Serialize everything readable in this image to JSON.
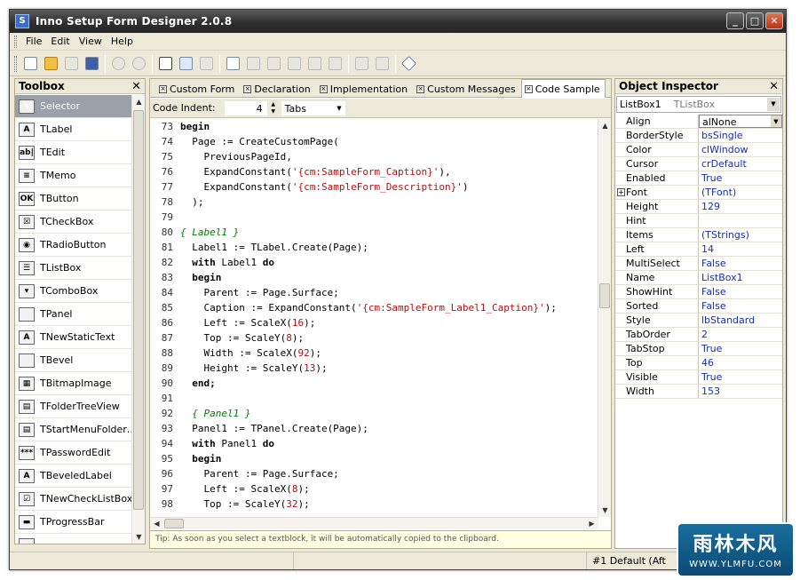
{
  "window": {
    "title": "Inno Setup Form Designer 2.0.8"
  },
  "menu": [
    "File",
    "Edit",
    "View",
    "Help"
  ],
  "toolbox": {
    "title": "Toolbox",
    "items": [
      {
        "label": "Selector",
        "icon": "cursor-icon",
        "glyph": "↖"
      },
      {
        "label": "TLabel",
        "icon": "label-icon",
        "glyph": "A"
      },
      {
        "label": "TEdit",
        "icon": "edit-icon",
        "glyph": "ab|"
      },
      {
        "label": "TMemo",
        "icon": "memo-icon",
        "glyph": "≡"
      },
      {
        "label": "TButton",
        "icon": "button-icon",
        "glyph": "OK"
      },
      {
        "label": "TCheckBox",
        "icon": "checkbox-icon",
        "glyph": "☒"
      },
      {
        "label": "TRadioButton",
        "icon": "radiobutton-icon",
        "glyph": "◉"
      },
      {
        "label": "TListBox",
        "icon": "listbox-icon",
        "glyph": "☰"
      },
      {
        "label": "TComboBox",
        "icon": "combobox-icon",
        "glyph": "▾"
      },
      {
        "label": "TPanel",
        "icon": "panel-icon",
        "glyph": ""
      },
      {
        "label": "TNewStaticText",
        "icon": "static-text-icon",
        "glyph": "A"
      },
      {
        "label": "TBevel",
        "icon": "bevel-icon",
        "glyph": ""
      },
      {
        "label": "TBitmapImage",
        "icon": "bitmap-image-icon",
        "glyph": "▦"
      },
      {
        "label": "TFolderTreeView",
        "icon": "folder-tree-icon",
        "glyph": "▤"
      },
      {
        "label": "TStartMenuFolder…",
        "icon": "start-menu-folder-icon",
        "glyph": "▤"
      },
      {
        "label": "TPasswordEdit",
        "icon": "password-edit-icon",
        "glyph": "***"
      },
      {
        "label": "TBeveledLabel",
        "icon": "beveled-label-icon",
        "glyph": "A"
      },
      {
        "label": "TNewCheckListBox",
        "icon": "check-listbox-icon",
        "glyph": "☑"
      },
      {
        "label": "TProgressBar",
        "icon": "progressbar-icon",
        "glyph": "▬"
      },
      {
        "label": "",
        "icon": "item-icon",
        "glyph": ""
      }
    ]
  },
  "tabs": [
    {
      "label": "Custom Form",
      "active": false
    },
    {
      "label": "Declaration",
      "active": false
    },
    {
      "label": "Implementation",
      "active": false
    },
    {
      "label": "Custom Messages",
      "active": false
    },
    {
      "label": "Code Sample",
      "active": true
    }
  ],
  "indent": {
    "label": "Code Indent:",
    "value": "4",
    "unit": "Tabs"
  },
  "code": [
    {
      "n": "73",
      "t": [
        {
          "c": "kw",
          "s": "begin"
        }
      ]
    },
    {
      "n": "74",
      "t": [
        {
          "c": "",
          "s": "  Page := CreateCustomPage("
        }
      ]
    },
    {
      "n": "75",
      "t": [
        {
          "c": "",
          "s": "    PreviousPageId,"
        }
      ]
    },
    {
      "n": "76",
      "t": [
        {
          "c": "",
          "s": "    ExpandConstant("
        },
        {
          "c": "str",
          "s": "'{cm:SampleForm_Caption}'"
        },
        {
          "c": "",
          "s": "),"
        }
      ]
    },
    {
      "n": "77",
      "t": [
        {
          "c": "",
          "s": "    ExpandConstant("
        },
        {
          "c": "str",
          "s": "'{cm:SampleForm_Description}'"
        },
        {
          "c": "",
          "s": ")"
        }
      ]
    },
    {
      "n": "78",
      "t": [
        {
          "c": "",
          "s": "  );"
        }
      ]
    },
    {
      "n": "79",
      "t": [
        {
          "c": "",
          "s": ""
        }
      ]
    },
    {
      "n": "80",
      "t": [
        {
          "c": "cmt",
          "s": "{ Label1 }"
        }
      ]
    },
    {
      "n": "81",
      "t": [
        {
          "c": "",
          "s": "  Label1 := TLabel.Create(Page);"
        }
      ]
    },
    {
      "n": "82",
      "t": [
        {
          "c": "kw",
          "s": "  with"
        },
        {
          "c": "",
          "s": " Label1 "
        },
        {
          "c": "kw",
          "s": "do"
        }
      ]
    },
    {
      "n": "83",
      "t": [
        {
          "c": "kw",
          "s": "  begin"
        }
      ]
    },
    {
      "n": "84",
      "t": [
        {
          "c": "",
          "s": "    Parent := Page.Surface;"
        }
      ]
    },
    {
      "n": "85",
      "t": [
        {
          "c": "",
          "s": "    Caption := ExpandConstant("
        },
        {
          "c": "str",
          "s": "'{cm:SampleForm_Label1_Caption}'"
        },
        {
          "c": "",
          "s": ");"
        }
      ]
    },
    {
      "n": "86",
      "t": [
        {
          "c": "",
          "s": "    Left := ScaleX("
        },
        {
          "c": "num",
          "s": "16"
        },
        {
          "c": "",
          "s": ");"
        }
      ]
    },
    {
      "n": "87",
      "t": [
        {
          "c": "",
          "s": "    Top := ScaleY("
        },
        {
          "c": "num",
          "s": "8"
        },
        {
          "c": "",
          "s": ");"
        }
      ]
    },
    {
      "n": "88",
      "t": [
        {
          "c": "",
          "s": "    Width := ScaleX("
        },
        {
          "c": "num",
          "s": "92"
        },
        {
          "c": "",
          "s": ");"
        }
      ]
    },
    {
      "n": "89",
      "t": [
        {
          "c": "",
          "s": "    Height := ScaleY("
        },
        {
          "c": "num",
          "s": "13"
        },
        {
          "c": "",
          "s": ");"
        }
      ]
    },
    {
      "n": "90",
      "t": [
        {
          "c": "kw",
          "s": "  end;"
        }
      ]
    },
    {
      "n": "91",
      "t": [
        {
          "c": "",
          "s": ""
        }
      ]
    },
    {
      "n": "92",
      "t": [
        {
          "c": "cmt",
          "s": "  { Panel1 }"
        }
      ]
    },
    {
      "n": "93",
      "t": [
        {
          "c": "",
          "s": "  Panel1 := TPanel.Create(Page);"
        }
      ]
    },
    {
      "n": "94",
      "t": [
        {
          "c": "kw",
          "s": "  with"
        },
        {
          "c": "",
          "s": " Panel1 "
        },
        {
          "c": "kw",
          "s": "do"
        }
      ]
    },
    {
      "n": "95",
      "t": [
        {
          "c": "kw",
          "s": "  begin"
        }
      ]
    },
    {
      "n": "96",
      "t": [
        {
          "c": "",
          "s": "    Parent := Page.Surface;"
        }
      ]
    },
    {
      "n": "97",
      "t": [
        {
          "c": "",
          "s": "    Left := ScaleX("
        },
        {
          "c": "num",
          "s": "8"
        },
        {
          "c": "",
          "s": ");"
        }
      ]
    },
    {
      "n": "98",
      "t": [
        {
          "c": "",
          "s": "    Top := ScaleY("
        },
        {
          "c": "num",
          "s": "32"
        },
        {
          "c": "",
          "s": ");"
        }
      ]
    }
  ],
  "tip": "Tip: As soon as you select a textblock, it will be automatically copied to the clipboard.",
  "inspector": {
    "title": "Object Inspector",
    "object": "ListBox1",
    "class": "TListBox",
    "props": [
      {
        "name": "Align",
        "value": "alNone",
        "selected": true
      },
      {
        "name": "BorderStyle",
        "value": "bsSingle"
      },
      {
        "name": "Color",
        "value": "clWindow"
      },
      {
        "name": "Cursor",
        "value": "crDefault"
      },
      {
        "name": "Enabled",
        "value": "True"
      },
      {
        "name": "Font",
        "value": "(TFont)",
        "expandable": true
      },
      {
        "name": "Height",
        "value": "129"
      },
      {
        "name": "Hint",
        "value": ""
      },
      {
        "name": "Items",
        "value": "(TStrings)"
      },
      {
        "name": "Left",
        "value": "14"
      },
      {
        "name": "MultiSelect",
        "value": "False"
      },
      {
        "name": "Name",
        "value": "ListBox1"
      },
      {
        "name": "ShowHint",
        "value": "False"
      },
      {
        "name": "Sorted",
        "value": "False"
      },
      {
        "name": "Style",
        "value": "lbStandard"
      },
      {
        "name": "TabOrder",
        "value": "2"
      },
      {
        "name": "TabStop",
        "value": "True"
      },
      {
        "name": "Top",
        "value": "46"
      },
      {
        "name": "Visible",
        "value": "True"
      },
      {
        "name": "Width",
        "value": "153"
      }
    ]
  },
  "status": {
    "cell3": "#1 Default (Aft"
  },
  "watermark": {
    "line1": "雨林木风",
    "line2": "WWW.YLMFU.COM"
  },
  "colors": {
    "title_bar": "#2f2f2f",
    "selection": "#9aa0a8",
    "property_value": "#1a2fa8",
    "string": "#b01010",
    "comment": "#008000",
    "tip_bg": "#ffffe1"
  }
}
